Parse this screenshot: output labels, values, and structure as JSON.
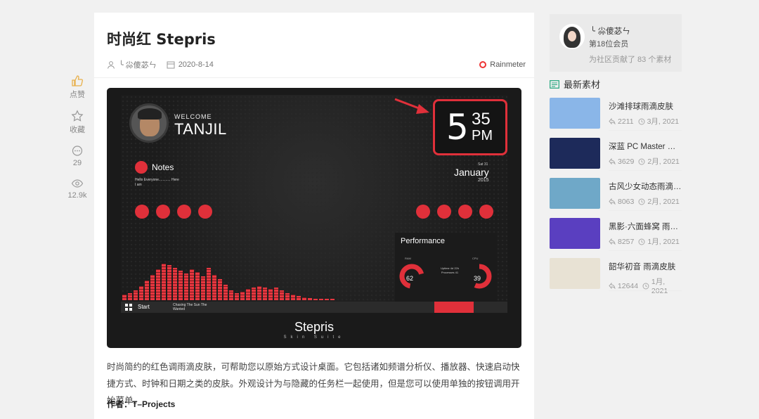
{
  "page": {
    "title": "时尚红 Stepris",
    "author": "╰ 尛傻苾ㄣ",
    "date": "2020-8-14",
    "category": "Rainmeter",
    "description": "时尚简约的红色调雨滴皮肤，可帮助您以原始方式设计桌面。它包括诸如频谱分析仪、播放器、快速启动快捷方式、时钟和日期之类的皮肤。外观设计为与隐藏的任务栏一起使用，但是您可以使用单独的按钮调用开始菜单。",
    "credit": "作者：T–Projects"
  },
  "rail": {
    "like_label": "点赞",
    "fav_label": "收藏",
    "comment_count": "29",
    "view_count": "12.9k"
  },
  "preview": {
    "welcome": "WELCOME",
    "name": "TANJIL",
    "clock_hour": "5",
    "clock_minute": "35",
    "clock_ampm": "PM",
    "notes_label": "Notes",
    "notes_text": "Hello Everyone............ Here I am",
    "date_small": "Sat 31",
    "date_month": "January",
    "date_year": "2015",
    "perf_title": "Performance",
    "ram_label": "RAM",
    "ram_value": "62",
    "cpu_label": "CPU",
    "cpu_value": "39",
    "uptime_text": "Uptime 4d 22h Processes 41",
    "start_label": "Start",
    "song_text": "Chasing The Sun The Wanted",
    "brand": "Stepris",
    "brand_sub": "Skin Suite"
  },
  "sidebar": {
    "username": "╰ 尛傻苾ㄣ",
    "rank": "第18位会员",
    "contrib": "为社区贡献了 83 个素材",
    "latest_heading": "最新素材",
    "items": [
      {
        "title": "沙滩排球雨滴皮肤",
        "views": "2211",
        "time": "3月, 2021",
        "color": "#8ab6e8"
      },
      {
        "title": "深蓝 PC Master 雨滴皮肤",
        "views": "3629",
        "time": "2月, 2021",
        "color": "#1d2a5a"
      },
      {
        "title": "古风少女动态雨滴皮肤",
        "views": "8063",
        "time": "2月, 2021",
        "color": "#6fa8c8"
      },
      {
        "title": "黑影·六面蜂窝 雨滴皮肤",
        "views": "8257",
        "time": "1月, 2021",
        "color": "#5a3fc0"
      },
      {
        "title": "韶华初音 雨滴皮肤",
        "views": "12644",
        "time": "1月, 2021",
        "color": "#e8e2d4"
      }
    ]
  }
}
